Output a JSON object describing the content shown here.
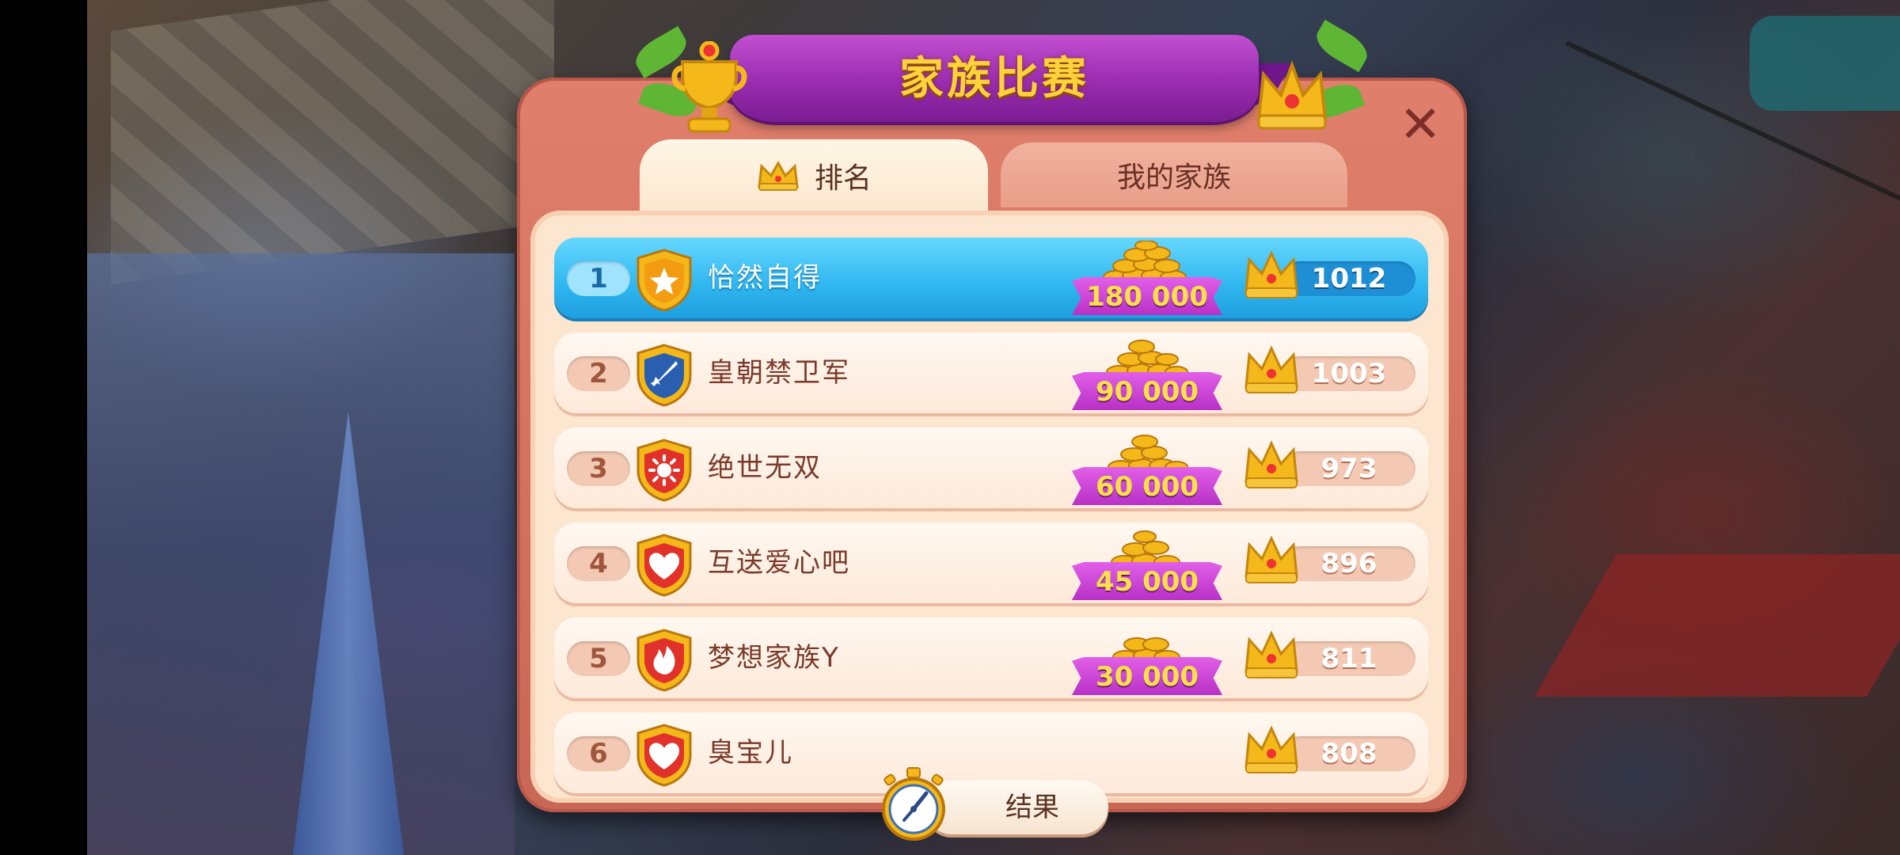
{
  "dialog": {
    "title": "家族比赛",
    "close_symbol": "✕"
  },
  "tabs": [
    {
      "label": "排名",
      "selected": true,
      "icon": "crown-icon"
    },
    {
      "label": "我的家族",
      "selected": false
    }
  ],
  "rankings": [
    {
      "rank": "1",
      "name": "恰然自得",
      "reward": "180 000",
      "score": "1012",
      "emblem": "star-shield-icon",
      "highlight": true
    },
    {
      "rank": "2",
      "name": "皇朝禁卫军",
      "reward": "90 000",
      "score": "1003",
      "emblem": "sword-shield-icon"
    },
    {
      "rank": "3",
      "name": "绝世无双",
      "reward": "60 000",
      "score": "973",
      "emblem": "sun-shield-icon"
    },
    {
      "rank": "4",
      "name": "互送爱心吧",
      "reward": "45 000",
      "score": "896",
      "emblem": "heart-shield-icon"
    },
    {
      "rank": "5",
      "name": "梦想家族Y",
      "reward": "30 000",
      "score": "811",
      "emblem": "flame-shield-icon"
    },
    {
      "rank": "6",
      "name": "臭宝儿",
      "reward": "",
      "score": "808",
      "emblem": "heart-shield-icon"
    }
  ],
  "footer": {
    "result_label": "结果"
  },
  "colors": {
    "panel": "#d2705e",
    "ribbon": "#9a2cb0",
    "title_text": "#ffd23a",
    "highlight_row": "#2fb6ef",
    "reward_banner": "#b731c6",
    "gold": "#f5b81a"
  }
}
